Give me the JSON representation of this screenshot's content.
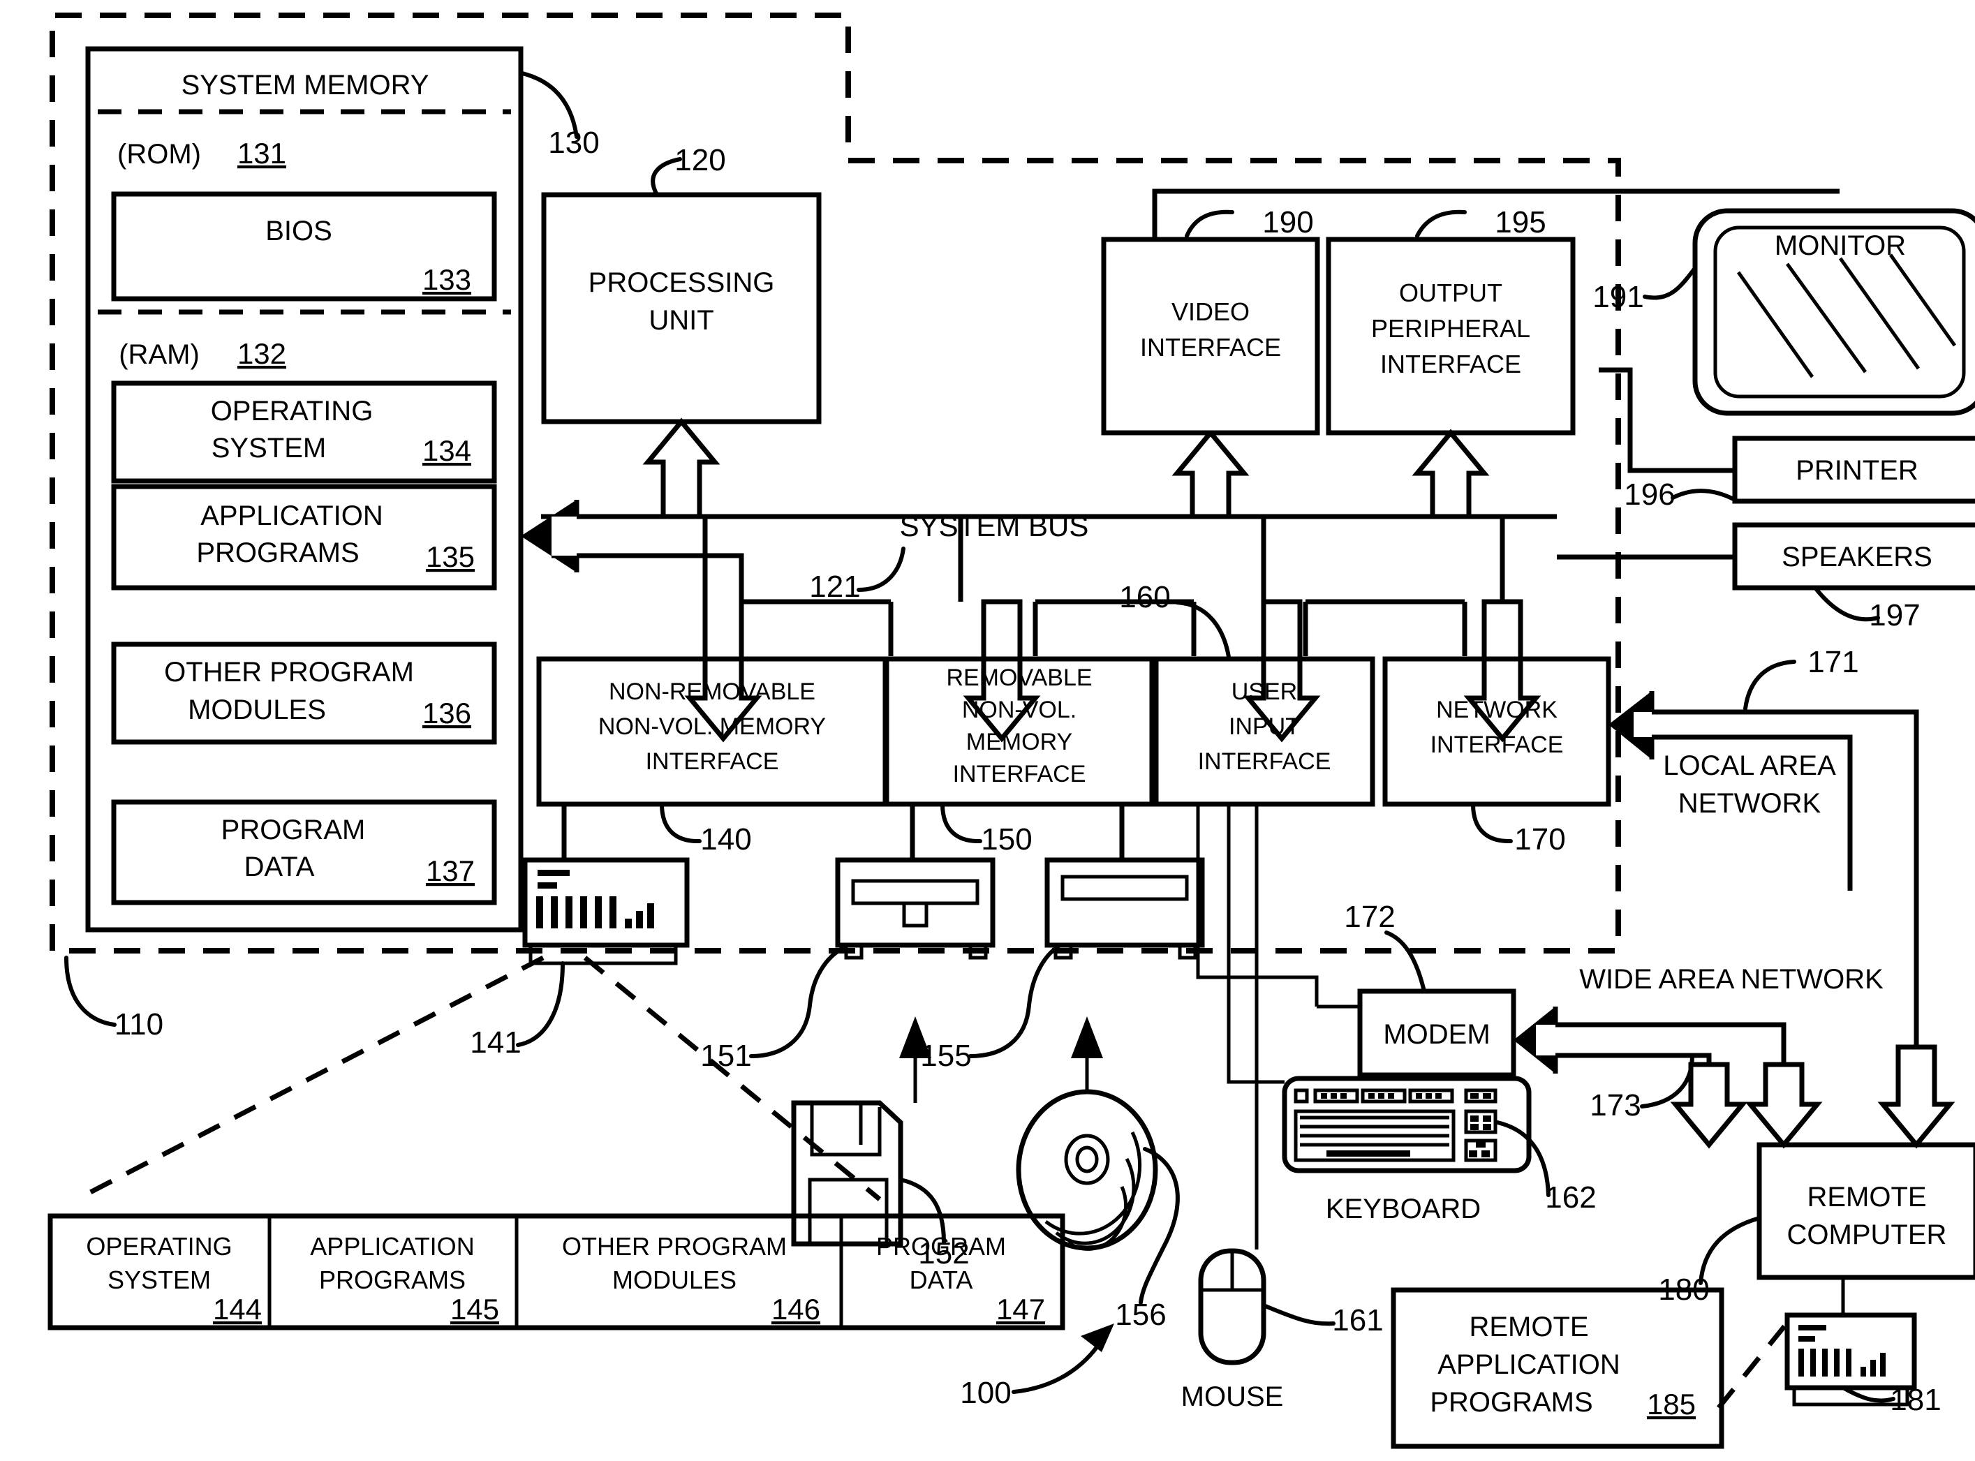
{
  "figure": {
    "ref_100": "100",
    "ref_110": "110"
  },
  "system_memory": {
    "title": "SYSTEM MEMORY",
    "ref": "130",
    "rom_label": "(ROM)",
    "rom_ref": "131",
    "bios_label": "BIOS",
    "bios_ref": "133",
    "ram_label": "(RAM)",
    "ram_ref": "132",
    "blocks": [
      {
        "line1": "OPERATING",
        "line2": "SYSTEM",
        "ref": "134"
      },
      {
        "line1": "APPLICATION",
        "line2": "PROGRAMS",
        "ref": "135"
      },
      {
        "line1": "OTHER PROGRAM",
        "line2": "MODULES",
        "ref": "136"
      },
      {
        "line1": "PROGRAM",
        "line2": "DATA",
        "ref": "137"
      }
    ]
  },
  "processing_unit": {
    "line1": "PROCESSING",
    "line2": "UNIT",
    "ref": "120"
  },
  "system_bus": {
    "label": "SYSTEM BUS",
    "ref": "121"
  },
  "video_interface": {
    "line1": "VIDEO",
    "line2": "INTERFACE",
    "ref": "190"
  },
  "output_peripheral_interface": {
    "line1": "OUTPUT",
    "line2": "PERIPHERAL",
    "line3": "INTERFACE",
    "ref": "195"
  },
  "monitor": {
    "label": "MONITOR",
    "ref": "191"
  },
  "printer": {
    "label": "PRINTER",
    "ref": "196"
  },
  "speakers": {
    "label": "SPEAKERS",
    "ref": "197"
  },
  "nonremovable_interface": {
    "line1": "NON-REMOVABLE",
    "line2": "NON-VOL. MEMORY",
    "line3": "INTERFACE",
    "ref": "140"
  },
  "removable_interface": {
    "line1": "REMOVABLE",
    "line2": "NON-VOL.",
    "line3": "MEMORY",
    "line4": "INTERFACE",
    "ref": "150"
  },
  "user_input_interface": {
    "line1": "USER",
    "line2": "INPUT",
    "line3": "INTERFACE",
    "ref": "160"
  },
  "network_interface": {
    "line1": "NETWORK",
    "line2": "INTERFACE",
    "ref": "170"
  },
  "local_area_network": {
    "line1": "LOCAL AREA",
    "line2": "NETWORK",
    "ref": "171"
  },
  "wide_area_network": {
    "label": "WIDE AREA NETWORK",
    "ref": "173"
  },
  "modem": {
    "label": "MODEM",
    "ref": "172"
  },
  "keyboard": {
    "label": "KEYBOARD",
    "ref": "162"
  },
  "mouse": {
    "label": "MOUSE",
    "ref": "161"
  },
  "hard_drive": {
    "ref": "141"
  },
  "floppy_drive": {
    "ref": "151"
  },
  "floppy_disk": {
    "ref": "152"
  },
  "optical_drive": {
    "ref": "155"
  },
  "optical_disc": {
    "ref": "156"
  },
  "remote_computer": {
    "line1": "REMOTE",
    "line2": "COMPUTER",
    "ref": "180"
  },
  "remote_storage": {
    "ref": "181"
  },
  "remote_application_programs": {
    "line1": "REMOTE",
    "line2": "APPLICATION",
    "line3": "PROGRAMS",
    "ref": "185"
  },
  "storage_table": {
    "cells": [
      {
        "line1": "OPERATING",
        "line2": "SYSTEM",
        "ref": "144"
      },
      {
        "line1": "APPLICATION",
        "line2": "PROGRAMS",
        "ref": "145"
      },
      {
        "line1": "OTHER PROGRAM",
        "line2": "MODULES",
        "ref": "146"
      },
      {
        "line1": "PROGRAM",
        "line2": "DATA",
        "ref": "147"
      }
    ]
  }
}
